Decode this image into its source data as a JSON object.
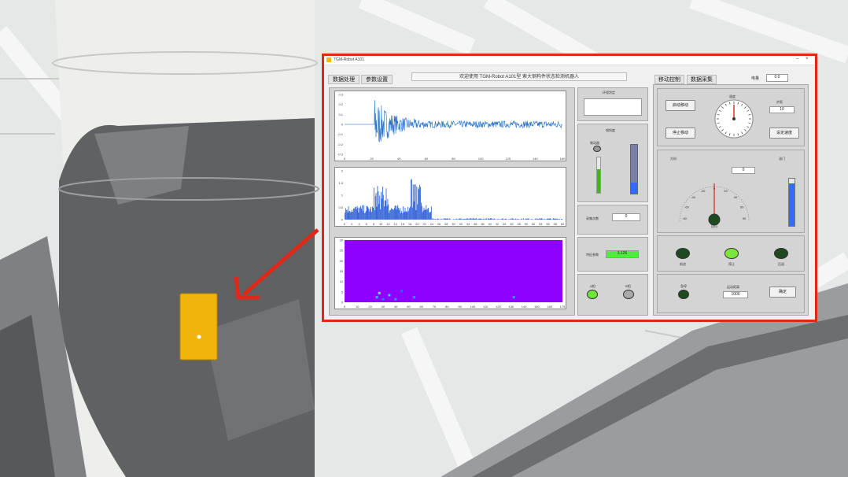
{
  "window": {
    "title": "TGM-Robot A101",
    "tabs_left": [
      "数据处理",
      "参数设置"
    ],
    "welcome": "欢迎使用 TGM-Robot A101型 索大钢构件状态检测机器人",
    "tabs_right": [
      "移动控制",
      "数据采集"
    ],
    "power_label": "电量",
    "power_value": "0.0"
  },
  "right_column": {
    "env_label": "环境判定",
    "slope_label": "倾斜度",
    "brake_label": "制动器",
    "accel_label": "采集次数",
    "accel_value": "0",
    "feature_label": "特征参数",
    "feature_value": "3.126",
    "led_a_label": "A相",
    "led_b_label": "B相"
  },
  "controls": {
    "start_move": "启动移动",
    "stop_move": "停止移动",
    "speed_label": "速度",
    "step_label": "步距",
    "step_value": "10",
    "confirm_speed": "设定速度",
    "direction_label": "方向",
    "direction_value": "0",
    "gauge_label": "油门",
    "dial_center_label": "回归",
    "leds": [
      "前进",
      "停止",
      "后退"
    ],
    "stop_label": "急停",
    "move_distance_label": "运动距离",
    "move_distance_value": "1000",
    "confirm": "确定"
  },
  "chart_data": [
    {
      "type": "line",
      "title": "",
      "x_ticks": [
        "0",
        "20",
        "40",
        "60",
        "80",
        "100",
        "120",
        "140",
        "160"
      ],
      "y_ticks": [
        "0.3",
        "0.2",
        "0.1",
        "0",
        "-0.1",
        "-0.2",
        "-0.3"
      ],
      "ylim": [
        -0.3,
        0.3
      ],
      "xlim": [
        0,
        160
      ],
      "description": "vibration waveform, burst near x≈24 decaying to x≈160"
    },
    {
      "type": "bar",
      "title": "",
      "x_ticks": [
        "0",
        "2",
        "4",
        "6",
        "8",
        "10",
        "12",
        "14",
        "16",
        "18",
        "20",
        "22",
        "24",
        "26",
        "28",
        "30",
        "32",
        "34",
        "36",
        "38",
        "40",
        "42",
        "44",
        "46",
        "48",
        "50",
        "52",
        "54",
        "56",
        "58",
        "60"
      ],
      "y_ticks": [
        "2",
        "1.5",
        "1",
        "0.5",
        "0"
      ],
      "ylim": [
        0,
        2
      ],
      "xlim": [
        0,
        60
      ],
      "description": "frequency spectrum with peaks around x≈10 and x≈20"
    },
    {
      "type": "heatmap",
      "title": "",
      "x_ticks": [
        "0",
        "10",
        "20",
        "30",
        "40",
        "50",
        "60",
        "70",
        "80",
        "90",
        "100",
        "110",
        "120",
        "130",
        "140",
        "150",
        "160",
        "175"
      ],
      "y_ticks": [
        "30",
        "25",
        "20",
        "15",
        "10",
        "5",
        "0"
      ],
      "xlim": [
        0,
        175
      ],
      "ylim": [
        0,
        30
      ],
      "base_color": "#8e00ff"
    }
  ],
  "colors": {
    "frame": "#e02818",
    "wave": "#1f6fc8",
    "heatmap": "#8e00ff",
    "led_green": "#2fa12a",
    "led_bright": "#7ee63a",
    "bar_fill": "#2458d6"
  }
}
